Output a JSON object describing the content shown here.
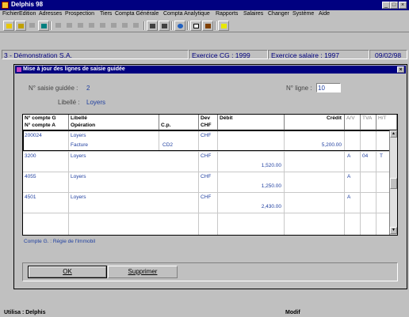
{
  "app": {
    "title": "Delphis 98"
  },
  "menu": [
    "Fichier",
    "Edition",
    "Adresses",
    "Prospection",
    "Tiers",
    "Compta Générale",
    "Compta Analytique",
    "Rapports",
    "Salaires",
    "Changer",
    "Système",
    "Aide"
  ],
  "toolbar": {
    "buttons": [
      "open-folder-icon",
      "edit-icon",
      "delete-icon",
      "phone-icon",
      "cut-icon",
      "copy-icon",
      "paste-icon",
      "undo-icon",
      "find-icon",
      "find-replace-icon",
      "print-icon",
      "key-icon",
      "preview-icon",
      "printer-icon",
      "globe-icon",
      "notepad-icon",
      "cards-icon",
      "help-icon"
    ]
  },
  "infobar": {
    "company": "3 - Démonstration S.A.",
    "exercice_cg": "Exercice CG : 1999",
    "exercice_salaire": "Exercice salaire :  1997",
    "date": "09/02/98"
  },
  "dialog": {
    "title": "Mise à jour des lignes de saisie guidée",
    "saisie_label": "N° saisie guidée :",
    "saisie_value": "2",
    "libelle_label": "Libellé :",
    "libelle_value": "Loyers",
    "ligne_label": "N° ligne :",
    "ligne_value": "10",
    "compte_info": "Compte G. : Régie de l'Immobil",
    "ok_label": "OK",
    "supprimer_label": "Supprimer"
  },
  "grid": {
    "headers": {
      "compte_g": "N° compte G",
      "compte_a": "N° compte A",
      "libelle": "Libellé",
      "operation": "Opération",
      "cp": "C.p.",
      "dev": "Dev",
      "chf": "CHF",
      "debit": "Débit",
      "credit": "Crédit",
      "av": "A/V",
      "tva": "TVA",
      "ht": "H/T"
    },
    "rows": [
      {
        "compte": "200024",
        "libelle": "Loyers",
        "operation": "Facture",
        "cp": "CD2",
        "dev": "CHF",
        "debit": "",
        "credit": "5,200.00",
        "av": "",
        "tva": "",
        "ht": ""
      },
      {
        "compte": "3200",
        "libelle": "Loyers",
        "operation": "",
        "cp": "",
        "dev": "CHF",
        "debit": "1,520.00",
        "credit": "",
        "av": "A",
        "tva": "04",
        "ht": "T"
      },
      {
        "compte": "4055",
        "libelle": "Loyers",
        "operation": "",
        "cp": "",
        "dev": "CHF",
        "debit": "1,250.00",
        "credit": "",
        "av": "A",
        "tva": "",
        "ht": ""
      },
      {
        "compte": "4501",
        "libelle": "Loyers",
        "operation": "",
        "cp": "",
        "dev": "CHF",
        "debit": "2,430.00",
        "credit": "",
        "av": "A",
        "tva": "",
        "ht": ""
      }
    ]
  },
  "statusbar": {
    "user": "Utilisa : Delphis",
    "mode": "Modif"
  }
}
